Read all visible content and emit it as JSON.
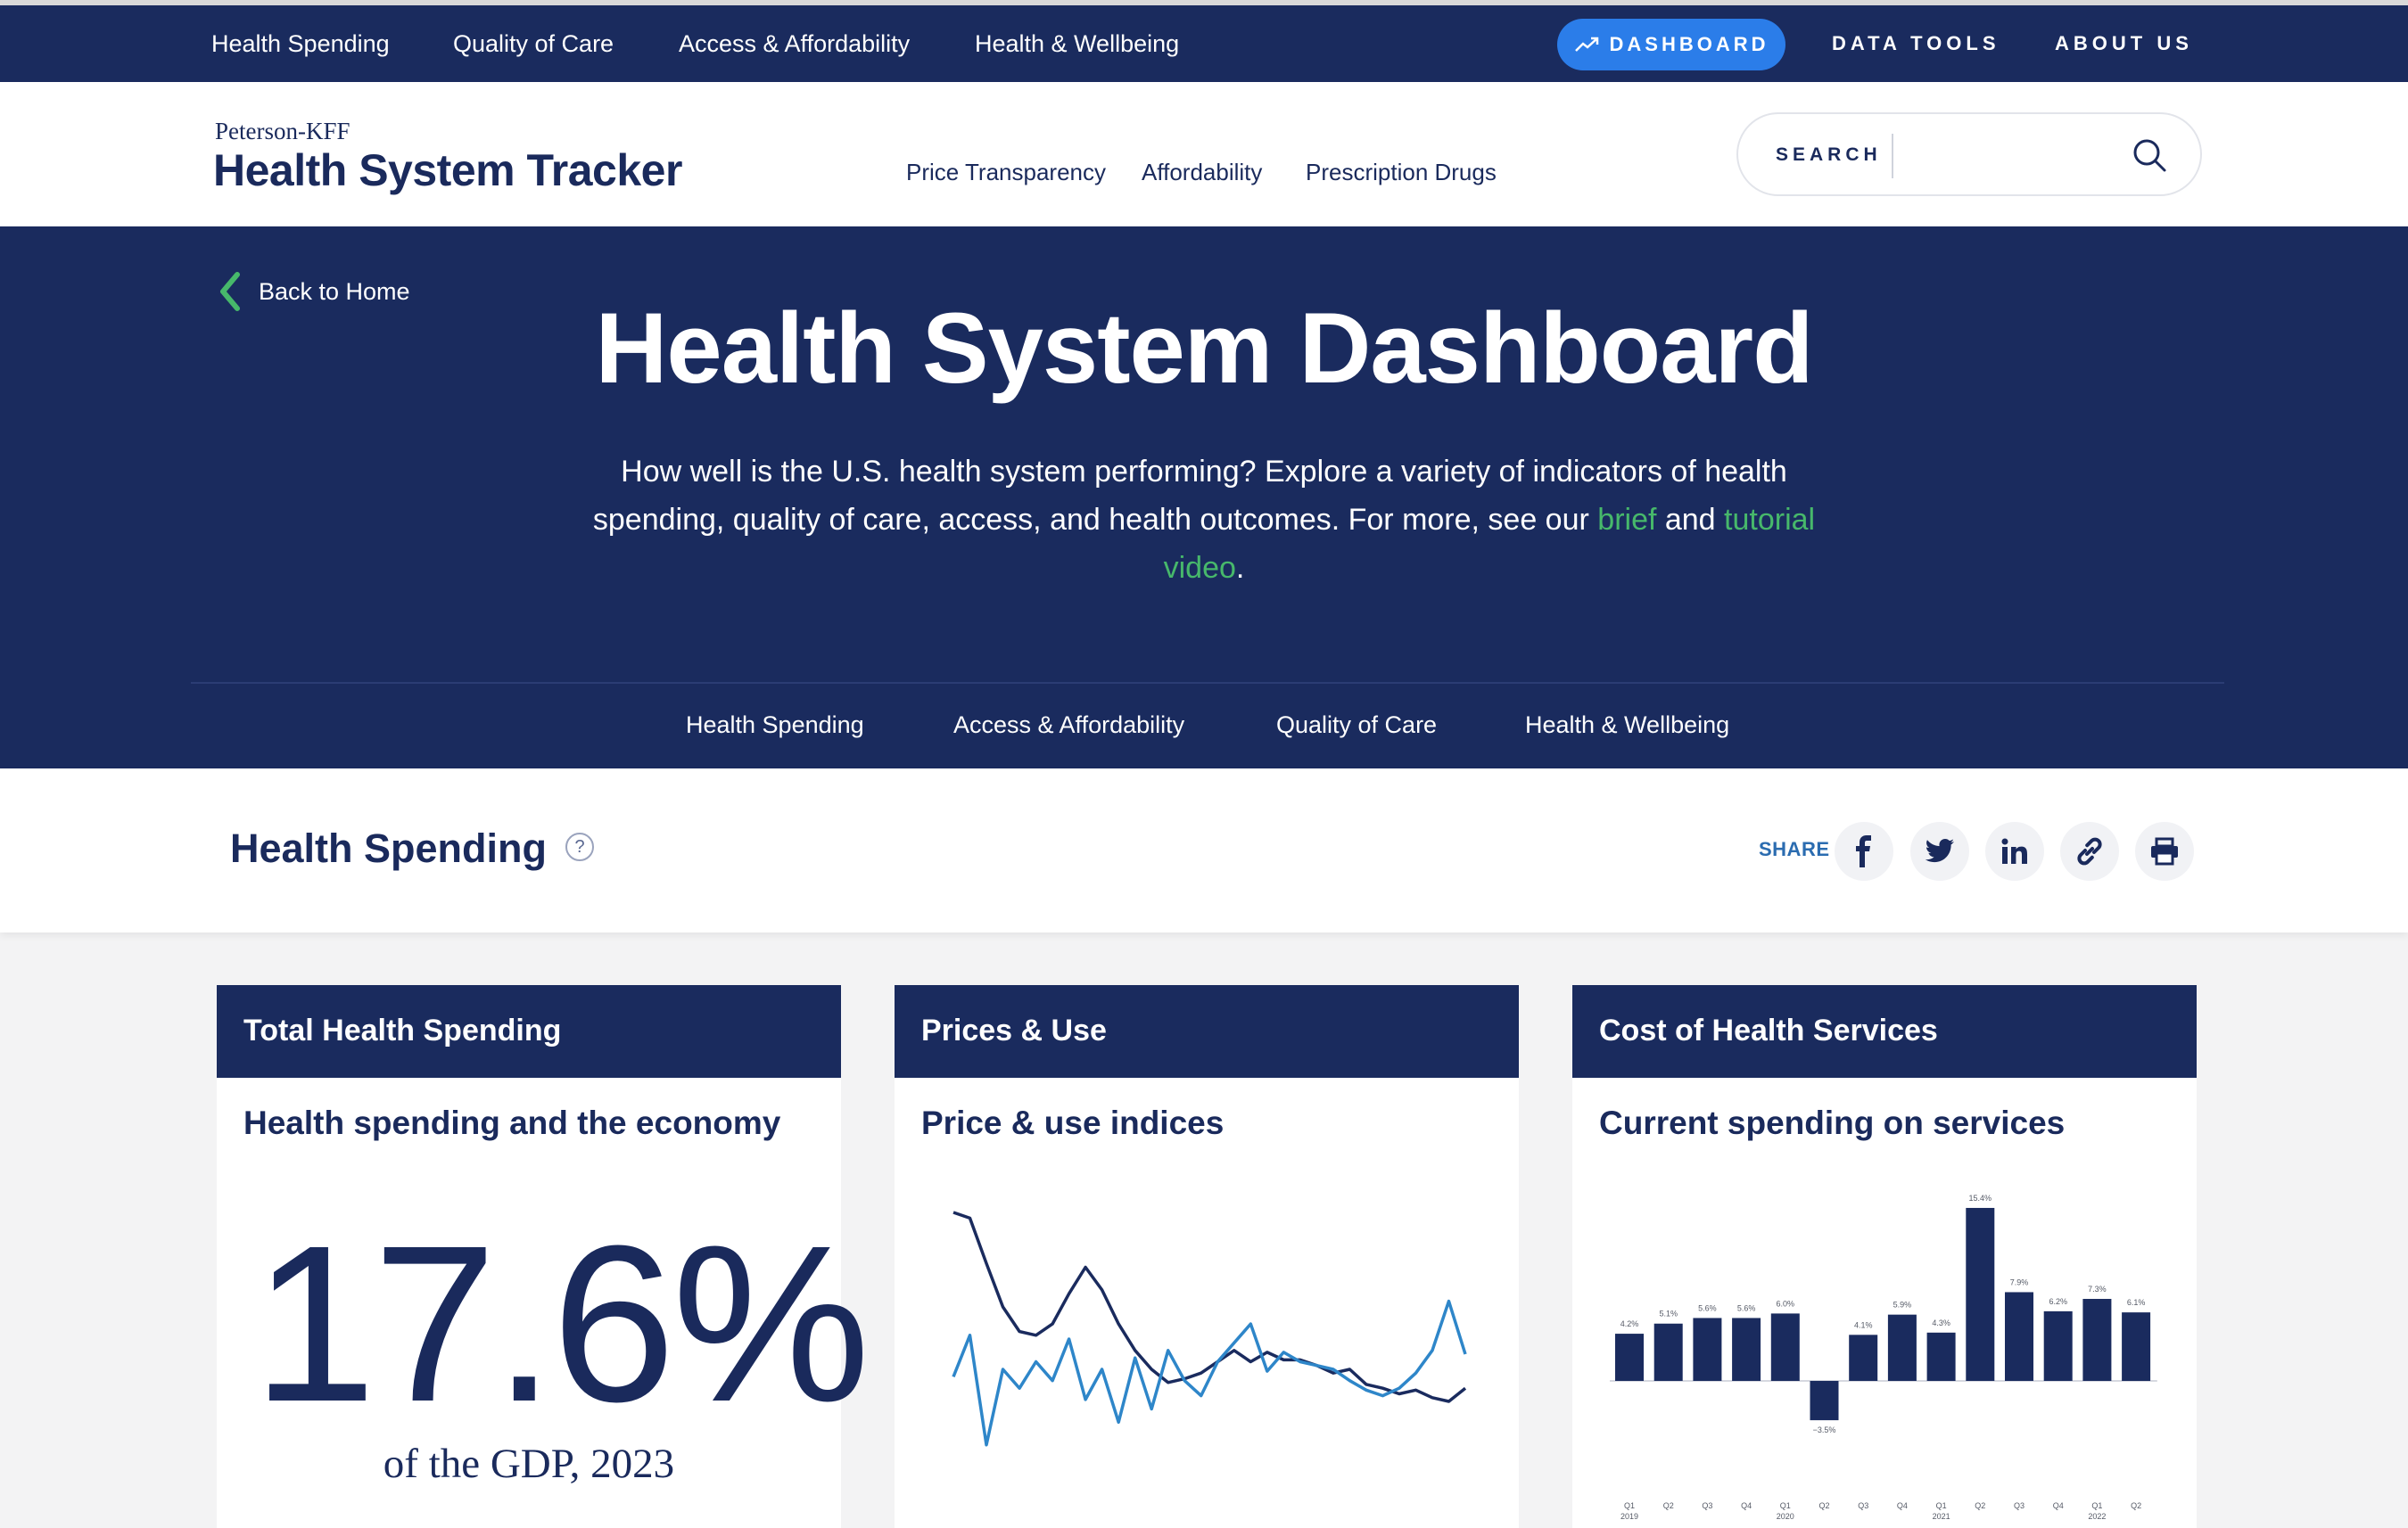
{
  "topbar": {
    "nav": [
      "Health Spending",
      "Quality of Care",
      "Access & Affordability",
      "Health & Wellbeing"
    ],
    "dashboard_label": "DASHBOARD",
    "data_tools_label": "DATA TOOLS",
    "about_label": "ABOUT US"
  },
  "header": {
    "logo_small": "Peterson-KFF",
    "logo_big": "Health System Tracker",
    "nav": [
      "Price Transparency",
      "Affordability",
      "Prescription Drugs"
    ],
    "search_label": "SEARCH",
    "search_placeholder": ""
  },
  "hero": {
    "back_label": "Back to Home",
    "title": "Health System Dashboard",
    "desc_before": "How well is the U.S. health system performing? Explore a variety of indicators of health spending, quality of care, access, and health outcomes. For more, see our ",
    "brief_link": "brief",
    "desc_middle": " and ",
    "tutorial_link": "tutorial video",
    "desc_after": ".",
    "subnav": [
      "Health Spending",
      "Access & Affordability",
      "Quality of Care",
      "Health & Wellbeing"
    ]
  },
  "section": {
    "title": "Health Spending",
    "help": "?",
    "share_label": "SHARE"
  },
  "cards": [
    {
      "header": "Total Health Spending",
      "subtitle": "Health spending and the economy",
      "stat": "17.6%",
      "caption": "of the GDP, 2023"
    },
    {
      "header": "Prices & Use",
      "subtitle": "Price & use indices"
    },
    {
      "header": "Cost of Health Services",
      "subtitle": "Current spending on services"
    }
  ],
  "chart_data": [
    {
      "type": "line",
      "title": "Price & use indices",
      "series": [
        {
          "color": "#1a2b5e",
          "values": [
            9.5,
            9.2,
            6.8,
            4.5,
            3.2,
            3.0,
            3.6,
            5.2,
            6.6,
            5.4,
            3.6,
            2.2,
            1.2,
            0.5,
            0.7,
            1.0,
            1.6,
            2.2,
            1.6,
            2.1,
            1.7,
            1.7,
            1.4,
            1.0,
            1.2,
            0.4,
            0.2,
            -0.1,
            0.1,
            -0.3,
            -0.5,
            0.2
          ]
        },
        {
          "color": "#2e86c9",
          "values": [
            0.8,
            3.0,
            -2.8,
            1.2,
            0.2,
            1.6,
            0.6,
            2.8,
            -0.4,
            1.2,
            -1.6,
            1.8,
            -0.9,
            2.2,
            0.6,
            -0.2,
            1.6,
            2.6,
            3.6,
            1.1,
            2.1,
            1.6,
            1.4,
            1.2,
            0.6,
            0.1,
            -0.2,
            0.2,
            1.0,
            2.2,
            4.8,
            2.0
          ]
        }
      ]
    },
    {
      "type": "bar",
      "title": "Current spending on services",
      "categories": [
        "Q1 2019",
        "Q2",
        "Q3",
        "Q4",
        "Q1 2020",
        "Q2",
        "Q3",
        "Q4",
        "Q1 2021",
        "Q2",
        "Q3",
        "Q4",
        "Q1 2022",
        "Q2"
      ],
      "tick_top": [
        "Q1",
        "Q2",
        "Q3",
        "Q4",
        "Q1",
        "Q2",
        "Q3",
        "Q4",
        "Q1",
        "Q2",
        "Q3",
        "Q4",
        "Q1",
        "Q2"
      ],
      "tick_bottom": [
        "2019",
        "",
        "",
        "",
        "2020",
        "",
        "",
        "",
        "2021",
        "",
        "",
        "",
        "2022",
        ""
      ],
      "values": [
        4.2,
        5.1,
        5.6,
        5.6,
        6.0,
        -3.5,
        4.1,
        5.9,
        4.3,
        15.4,
        7.9,
        6.2,
        7.3,
        6.1
      ],
      "labels": [
        "4.2%",
        "5.1%",
        "5.6%",
        "5.6%",
        "6.0%",
        "−3.5%",
        "4.1%",
        "5.9%",
        "4.3%",
        "15.4%",
        "7.9%",
        "6.2%",
        "7.3%",
        "6.1%"
      ],
      "bar_color": "#1a2b5e"
    }
  ]
}
